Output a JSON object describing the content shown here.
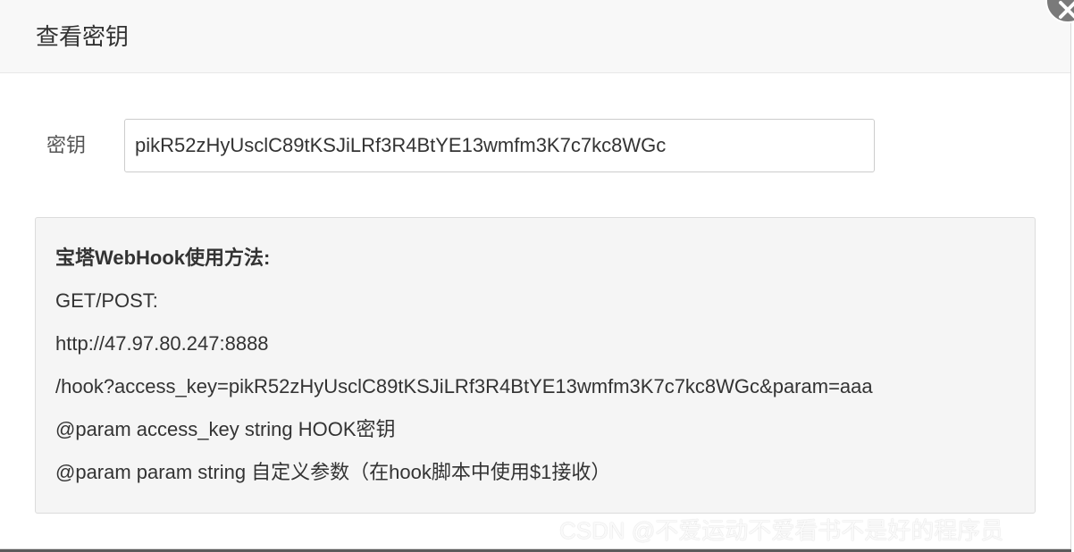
{
  "dialog": {
    "title": "查看密钥",
    "close_icon": "close-icon"
  },
  "key_field": {
    "label": "密钥",
    "value": "pikR52zHyUsclC89tKSJiLRf3R4BtYE13wmfm3K7c7kc8WGc"
  },
  "usage": {
    "title": "宝塔WebHook使用方法:",
    "lines": [
      "GET/POST:",
      "http://47.97.80.247:8888",
      "/hook?access_key=pikR52zHyUsclC89tKSJiLRf3R4BtYE13wmfm3K7c7kc8WGc&param=aaa",
      "@param access_key string HOOK密钥",
      "@param param string 自定义参数（在hook脚本中使用$1接收）"
    ]
  },
  "watermark": "CSDN @不爱运动不爱看书不是好的程序员"
}
